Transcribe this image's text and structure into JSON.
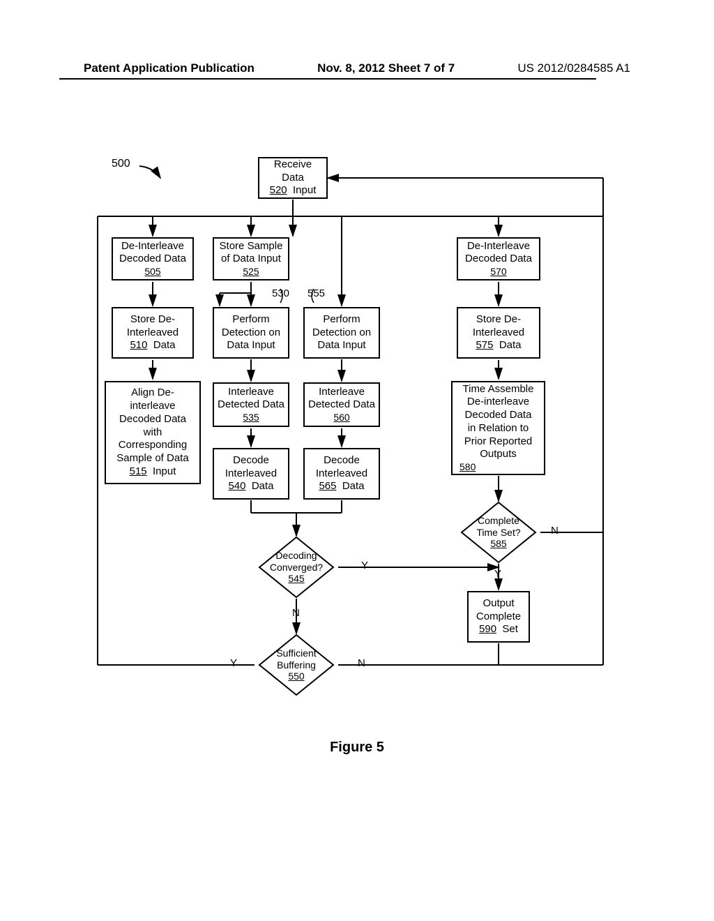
{
  "header": {
    "left": "Patent Application Publication",
    "mid": "Nov. 8, 2012  Sheet 7 of 7",
    "right": "US 2012/0284585 A1"
  },
  "figure": {
    "caption": "Figure 5",
    "label500": "500",
    "boxes": {
      "b520_l1": "Receive Data",
      "b520_l2": "Input",
      "b520_ref": "520",
      "b505_l1": "De-Interleave",
      "b505_l2": "Decoded Data",
      "b505_ref": "505",
      "b525_l1": "Store Sample",
      "b525_l2": "of Data Input",
      "b525_ref": "525",
      "b570_l1": "De-Interleave",
      "b570_l2": "Decoded Data",
      "b570_ref": "570",
      "b510_l1": "Store De-",
      "b510_l2": "Interleaved",
      "b510_l3": "Data",
      "b510_ref": "510",
      "b530_l1": "Perform",
      "b530_l2": "Detection on",
      "b530_l3": "Data Input",
      "b530_ref": "530",
      "b555_l1": "Perform",
      "b555_l2": "Detection on",
      "b555_l3": "Data Input",
      "b555_ref": "555",
      "b575_l1": "Store De-",
      "b575_l2": "Interleaved",
      "b575_l3": "Data",
      "b575_ref": "575",
      "b515_l1": "Align De-",
      "b515_l2": "interleave",
      "b515_l3": "Decoded Data",
      "b515_l4": "with",
      "b515_l5": "Corresponding",
      "b515_l6": "Sample of Data",
      "b515_l7": "Input",
      "b515_ref": "515",
      "b535_l1": "Interleave",
      "b535_l2": "Detected Data",
      "b535_ref": "535",
      "b560_l1": "Interleave",
      "b560_l2": "Detected Data",
      "b560_ref": "560",
      "b580_l1": "Time Assemble",
      "b580_l2": "De-interleave",
      "b580_l3": "Decoded Data",
      "b580_l4": "in Relation to",
      "b580_l5": "Prior Reported",
      "b580_l6": "Outputs",
      "b580_ref": "580",
      "b540_l1": "Decode",
      "b540_l2": "Interleaved",
      "b540_l3": "Data",
      "b540_ref": "540",
      "b565_l1": "Decode",
      "b565_l2": "Interleaved",
      "b565_l3": "Data",
      "b565_ref": "565",
      "b590_l1": "Output",
      "b590_l2": "Complete",
      "b590_l3": "Set",
      "b590_ref": "590"
    },
    "diamonds": {
      "d545_l1": "Decoding",
      "d545_l2": "Converged?",
      "d545_ref": "545",
      "d550_l1": "Sufficient",
      "d550_l2": "Buffering",
      "d550_ref": "550",
      "d585_l1": "Complete",
      "d585_l2": "Time Set?",
      "d585_ref": "585"
    },
    "ann": {
      "y1": "Y",
      "n1": "N",
      "y2": "Y",
      "n2": "N",
      "y3": "Y",
      "n3": "N"
    }
  }
}
